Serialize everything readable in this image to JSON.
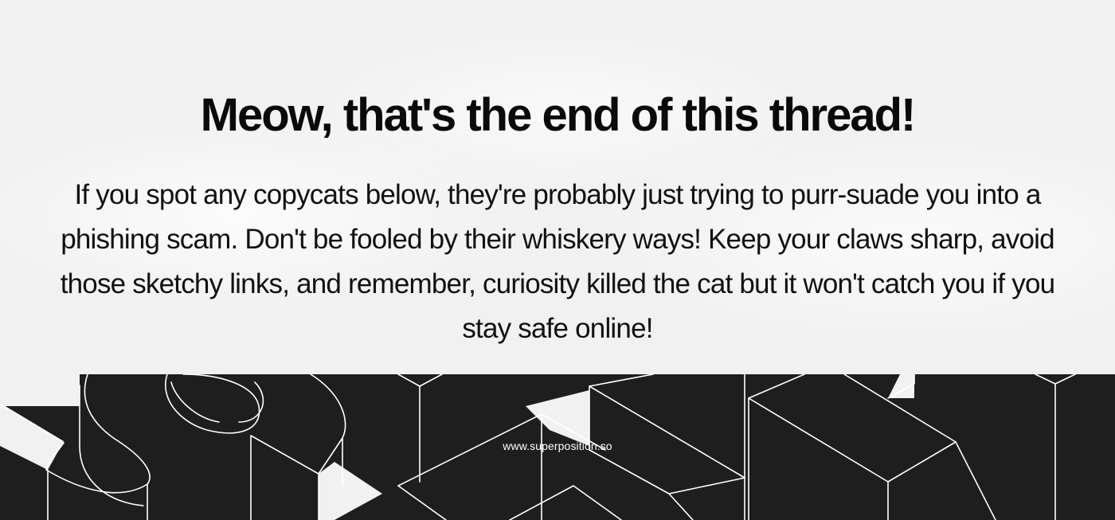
{
  "headline": "Meow, that's the end of this thread!",
  "body": "If you spot any copycats below, they're probably just trying to purr-suade you into a phishing scam. Don't be fooled by their whiskery ways! Keep your claws sharp, avoid those sketchy links, and remember, curiosity killed the cat but it won't catch you if you stay safe online!",
  "footer": {
    "url": "www.superposition.so"
  },
  "colors": {
    "background": "#f1f1f2",
    "text": "#0a0a0a",
    "art_fill": "#1e1e1e",
    "art_stroke": "#ffffff"
  },
  "art": {
    "icon": "isometric-letters-graphic"
  }
}
